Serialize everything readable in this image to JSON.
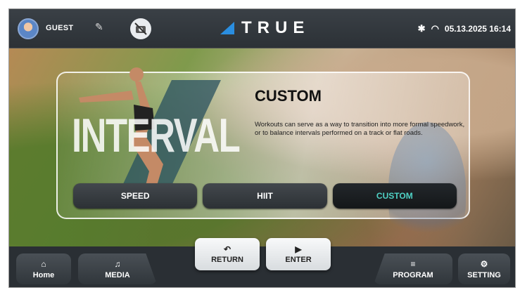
{
  "topbar": {
    "user": "GUEST",
    "brand": "TRUE",
    "datetime": "05.13.2025 16:14",
    "icons": {
      "edit": "pencil-icon",
      "no_image": "no-image-icon",
      "bluetooth": "bluetooth-off-icon",
      "wifi": "wifi-icon"
    }
  },
  "card": {
    "watermark": "INTERVAL",
    "title": "CUSTOM",
    "description": "Workouts can serve as a way to transition into more formal speedwork, or to balance intervals performed on a track or flat roads.",
    "options": [
      {
        "label": "SPEED",
        "selected": false
      },
      {
        "label": "HIIT",
        "selected": false
      },
      {
        "label": "CUSTOM",
        "selected": true
      }
    ],
    "accent_color": "#4fd1c5"
  },
  "bottombar": {
    "home": "Home",
    "media": "MEDIA",
    "return": "RETURN",
    "enter": "ENTER",
    "program": "PROGRAM",
    "setting": "SETTING"
  }
}
